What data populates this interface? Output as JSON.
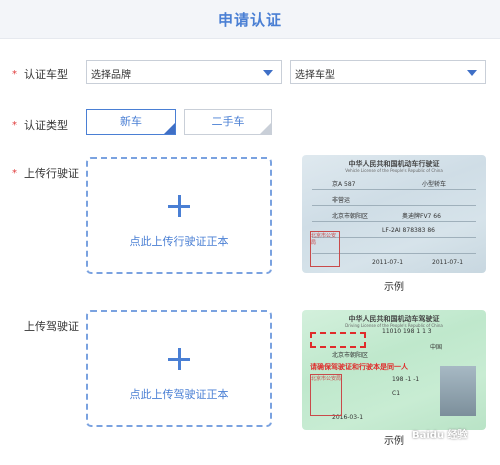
{
  "header": {
    "title": "申请认证"
  },
  "form": {
    "required_mark": "*",
    "vehicle_model": {
      "label": "认证车型",
      "brand_select": "选择品牌",
      "model_select": "选择车型"
    },
    "cert_type": {
      "label": "认证类型",
      "options": [
        "新车",
        "二手车"
      ],
      "selected": "新车"
    },
    "vehicle_license": {
      "label": "上传行驶证",
      "upload_text": "点此上传行驶证正本",
      "example_caption": "示例"
    },
    "driver_license": {
      "label": "上传驾驶证",
      "upload_text": "点此上传驾驶证正本",
      "example_caption": "示例"
    }
  },
  "examples": {
    "vehicle_card": {
      "title": "中华人民共和国机动车行驶证",
      "subtitle": "Vehicle License of the People's Republic of China",
      "fields": [
        "京A 587",
        "小型轿车",
        "北京市朝阳区",
        "非营运",
        "奥迪牌FV7 66",
        "LF-2AI 878383 86",
        "2011-07-1",
        "2011-07-1"
      ],
      "stamp": "北京市公安局"
    },
    "driver_card": {
      "title": "中华人民共和国机动车驾驶证",
      "subtitle": "Driving License of the People's Republic of China",
      "fields": [
        "11010 198 1 1 3",
        "中国",
        "北京市朝阳区",
        "198 -1 -1",
        "C1",
        "2016-03-1"
      ],
      "warning": "请确保驾驶证和行驶本是同一人",
      "stamp": "北京市公安局"
    },
    "watermark": "Baidu 经验"
  },
  "colors": {
    "accent": "#4a7fd4",
    "required": "#e03a3a",
    "warning": "#e02b2b"
  }
}
